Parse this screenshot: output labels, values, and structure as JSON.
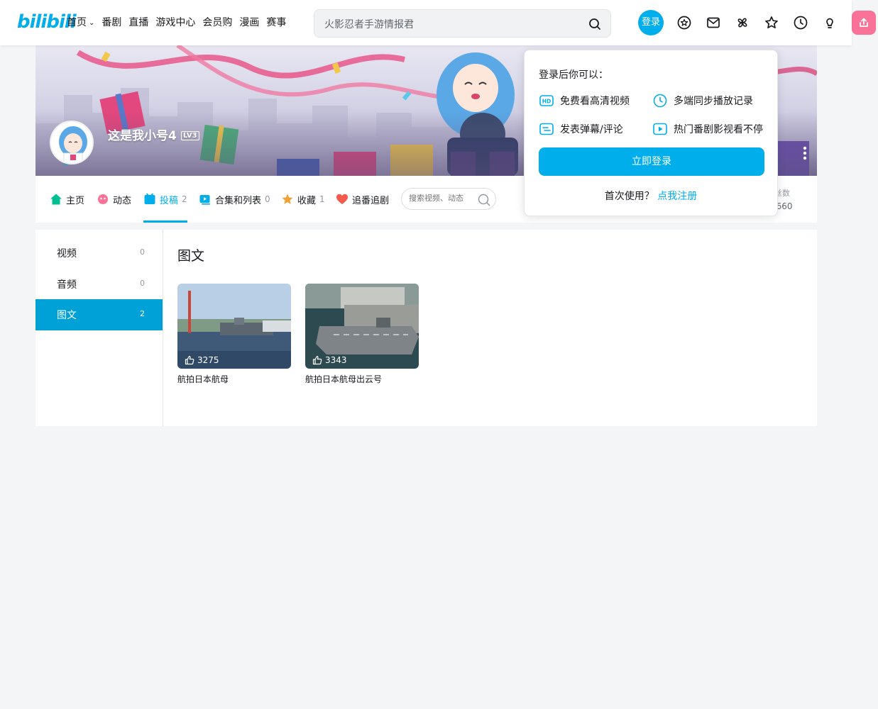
{
  "header": {
    "logo": "bilibili",
    "nav": [
      {
        "label": "首页",
        "chevron": true
      },
      {
        "label": "番剧"
      },
      {
        "label": "直播"
      },
      {
        "label": "游戏中心"
      },
      {
        "label": "会员购"
      },
      {
        "label": "漫画"
      },
      {
        "label": "赛事"
      }
    ],
    "search_value": "火影忍者手游情报君",
    "login_label": "登录",
    "icons": [
      "vip-icon",
      "message-icon",
      "dynamic-icon",
      "favorite-icon",
      "history-icon",
      "creation-icon",
      "upload-icon"
    ]
  },
  "banner": {
    "username": "这是我小号4",
    "level": "LV3"
  },
  "tabs": [
    {
      "label": "主页",
      "count": "",
      "icon": "home-icon",
      "color": "#00c091"
    },
    {
      "label": "动态",
      "count": "",
      "icon": "dynamic-icon",
      "color": "#fb7299"
    },
    {
      "label": "投稿",
      "count": "2",
      "icon": "upload-icon",
      "color": "#00aeec"
    },
    {
      "label": "合集和列表",
      "count": "0",
      "icon": "collection-icon",
      "color": "#00aeec"
    },
    {
      "label": "收藏",
      "count": "1",
      "icon": "favorite-icon",
      "color": "#f3a034"
    },
    {
      "label": "追番追剧",
      "count": "",
      "icon": "heart-icon",
      "color": "#f45a4d"
    }
  ],
  "space_search_placeholder": "搜索视频、动态",
  "stats": {
    "label": "粉丝数",
    "value": "4660"
  },
  "sidebar": [
    {
      "label": "视频",
      "count": "0"
    },
    {
      "label": "音频",
      "count": "0"
    },
    {
      "label": "图文",
      "count": "2"
    }
  ],
  "section_title": "图文",
  "articles": [
    {
      "title": "航拍日本航母",
      "likes": "3275"
    },
    {
      "title": "航拍日本航母出云号",
      "likes": "3343"
    }
  ],
  "popup": {
    "title": "登录后你可以：",
    "features": [
      "免费看高清视频",
      "多端同步播放记录",
      "发表弹幕/评论",
      "热门番剧影视看不停"
    ],
    "login_button": "立即登录",
    "register_prompt": "首次使用？",
    "register_link": "点我注册"
  },
  "colors": {
    "accent": "#00aeec",
    "pink": "#fb7299"
  }
}
